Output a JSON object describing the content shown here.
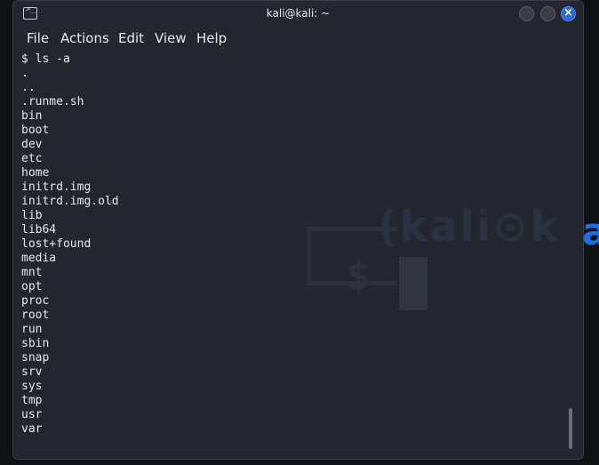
{
  "window": {
    "title": "kali@kali: ~"
  },
  "window_controls": {
    "close_glyph": "×"
  },
  "menu": {
    "items": [
      "File",
      "Actions",
      "Edit",
      "View",
      "Help"
    ]
  },
  "terminal": {
    "lines": [
      "$ ls -a",
      ".",
      "..",
      ".runme.sh",
      "bin",
      "boot",
      "dev",
      "etc",
      "home",
      "initrd.img",
      "initrd.img.old",
      "lib",
      "lib64",
      "lost+found",
      "media",
      "mnt",
      "opt",
      "proc",
      "root",
      "run",
      "sbin",
      "snap",
      "srv",
      "sys",
      "tmp",
      "usr",
      "var"
    ]
  },
  "wallpaper": {
    "logo_text": "(kali⊙k",
    "prompt_glyph": "$",
    "edge_logo_text": "a"
  },
  "icons": {
    "app_icon": "terminal-icon",
    "app_icon_glyph": ">_"
  },
  "colors": {
    "background": "#23262e",
    "text": "#e6e8ee",
    "close_button": "#2b68d8",
    "kali_blue": "#1f6fe0"
  }
}
